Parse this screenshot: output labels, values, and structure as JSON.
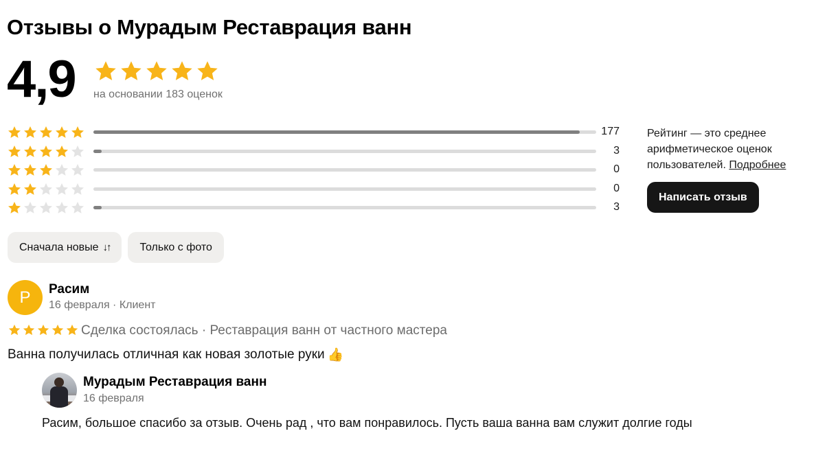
{
  "page": {
    "title": "Отзывы о Мурадым Реставрация ванн"
  },
  "summary": {
    "score": "4,9",
    "stars_filled": 5,
    "basis": "на основании 183 оценок"
  },
  "distribution": [
    {
      "stars": 5,
      "count": "177",
      "fraction": 0.967
    },
    {
      "stars": 4,
      "count": "3",
      "fraction": 0.016
    },
    {
      "stars": 3,
      "count": "0",
      "fraction": 0
    },
    {
      "stars": 2,
      "count": "0",
      "fraction": 0
    },
    {
      "stars": 1,
      "count": "3",
      "fraction": 0.016
    }
  ],
  "info": {
    "text": "Рейтинг — это среднее арифметическое оценок пользователей. ",
    "link": "Подробнее",
    "write_button": "Написать отзыв"
  },
  "filters": {
    "sort_label": "Сначала новые",
    "sort_icon": "↓↑",
    "photo_label": "Только с фото"
  },
  "review": {
    "avatar_letter": "Р",
    "author": "Расим",
    "meta": "16 февраля · Клиент",
    "rating": 5,
    "deal": "Сделка состоялась · Реставрация ванн от частного мастера",
    "text": "Ванна получилась отличная как новая золотые руки",
    "emoji": "👍"
  },
  "reply": {
    "author": "Мурадым Реставрация ванн",
    "date": "16 февраля",
    "text": "Расим, большое спасибо за отзыв. Очень рад , что вам понравилось. Пусть ваша ванна вам служит долгие годы"
  },
  "colors": {
    "star_filled": "#f8b419",
    "star_empty": "#e3e3e3",
    "bar_fill": "#808080",
    "bar_track": "#dcdcdc",
    "button_dark": "#161616",
    "avatar_bg": "#f6b50d"
  }
}
